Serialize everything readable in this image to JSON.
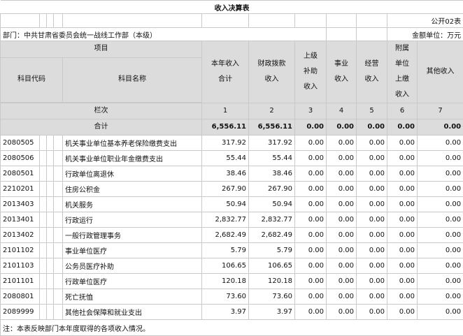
{
  "title": "收入决算表",
  "form_code": "公开02表",
  "department": "部门：中共甘肃省委员会统一战线工作部（本级）",
  "unit": "金额单位：万元",
  "headers": {
    "project": "项目",
    "code": "科目代码",
    "name": "科目名称",
    "col1": [
      "本年收入",
      "合计"
    ],
    "col2": [
      "财政拨款",
      "收入"
    ],
    "col3": [
      "上级",
      "补助",
      "收入"
    ],
    "col4": [
      "事业",
      "收入"
    ],
    "col5": [
      "经营",
      "收入"
    ],
    "col6": [
      "附属",
      "单位",
      "上缴",
      "收入"
    ],
    "col7": [
      "其他收入"
    ],
    "line_label": "栏次",
    "line_numbers": [
      "1",
      "2",
      "3",
      "4",
      "5",
      "6",
      "7"
    ]
  },
  "total": {
    "label": "合计",
    "values": [
      "6,556.11",
      "6,556.11",
      "0.00",
      "0.00",
      "0.00",
      "0.00",
      "0.00"
    ]
  },
  "rows": [
    {
      "code": "2080505",
      "name": "机关事业单位基本养老保险缴费支出",
      "values": [
        "317.92",
        "317.92",
        "0.00",
        "0.00",
        "0.00",
        "0.00",
        "0.00"
      ]
    },
    {
      "code": "2080506",
      "name": "机关事业单位职业年金缴费支出",
      "values": [
        "55.44",
        "55.44",
        "0.00",
        "0.00",
        "0.00",
        "0.00",
        "0.00"
      ]
    },
    {
      "code": "2080501",
      "name": "行政单位离退休",
      "values": [
        "38.46",
        "38.46",
        "0.00",
        "0.00",
        "0.00",
        "0.00",
        "0.00"
      ]
    },
    {
      "code": "2210201",
      "name": "住房公积金",
      "values": [
        "267.90",
        "267.90",
        "0.00",
        "0.00",
        "0.00",
        "0.00",
        "0.00"
      ]
    },
    {
      "code": "2013403",
      "name": "机关服务",
      "values": [
        "50.94",
        "50.94",
        "0.00",
        "0.00",
        "0.00",
        "0.00",
        "0.00"
      ]
    },
    {
      "code": "2013401",
      "name": "行政运行",
      "values": [
        "2,832.77",
        "2,832.77",
        "0.00",
        "0.00",
        "0.00",
        "0.00",
        "0.00"
      ]
    },
    {
      "code": "2013402",
      "name": "一般行政管理事务",
      "values": [
        "2,682.49",
        "2,682.49",
        "0.00",
        "0.00",
        "0.00",
        "0.00",
        "0.00"
      ]
    },
    {
      "code": "2101102",
      "name": "事业单位医疗",
      "values": [
        "5.79",
        "5.79",
        "0.00",
        "0.00",
        "0.00",
        "0.00",
        "0.00"
      ]
    },
    {
      "code": "2101103",
      "name": "公务员医疗补助",
      "values": [
        "106.65",
        "106.65",
        "0.00",
        "0.00",
        "0.00",
        "0.00",
        "0.00"
      ]
    },
    {
      "code": "2101101",
      "name": "行政单位医疗",
      "values": [
        "120.18",
        "120.18",
        "0.00",
        "0.00",
        "0.00",
        "0.00",
        "0.00"
      ]
    },
    {
      "code": "2080801",
      "name": "死亡抚恤",
      "values": [
        "73.60",
        "73.60",
        "0.00",
        "0.00",
        "0.00",
        "0.00",
        "0.00"
      ]
    },
    {
      "code": "2089999",
      "name": "其他社会保障和就业支出",
      "values": [
        "3.97",
        "3.97",
        "0.00",
        "0.00",
        "0.00",
        "0.00",
        "0.00"
      ]
    }
  ],
  "note": "注：本表反映部门本年度取得的各项收入情况。"
}
